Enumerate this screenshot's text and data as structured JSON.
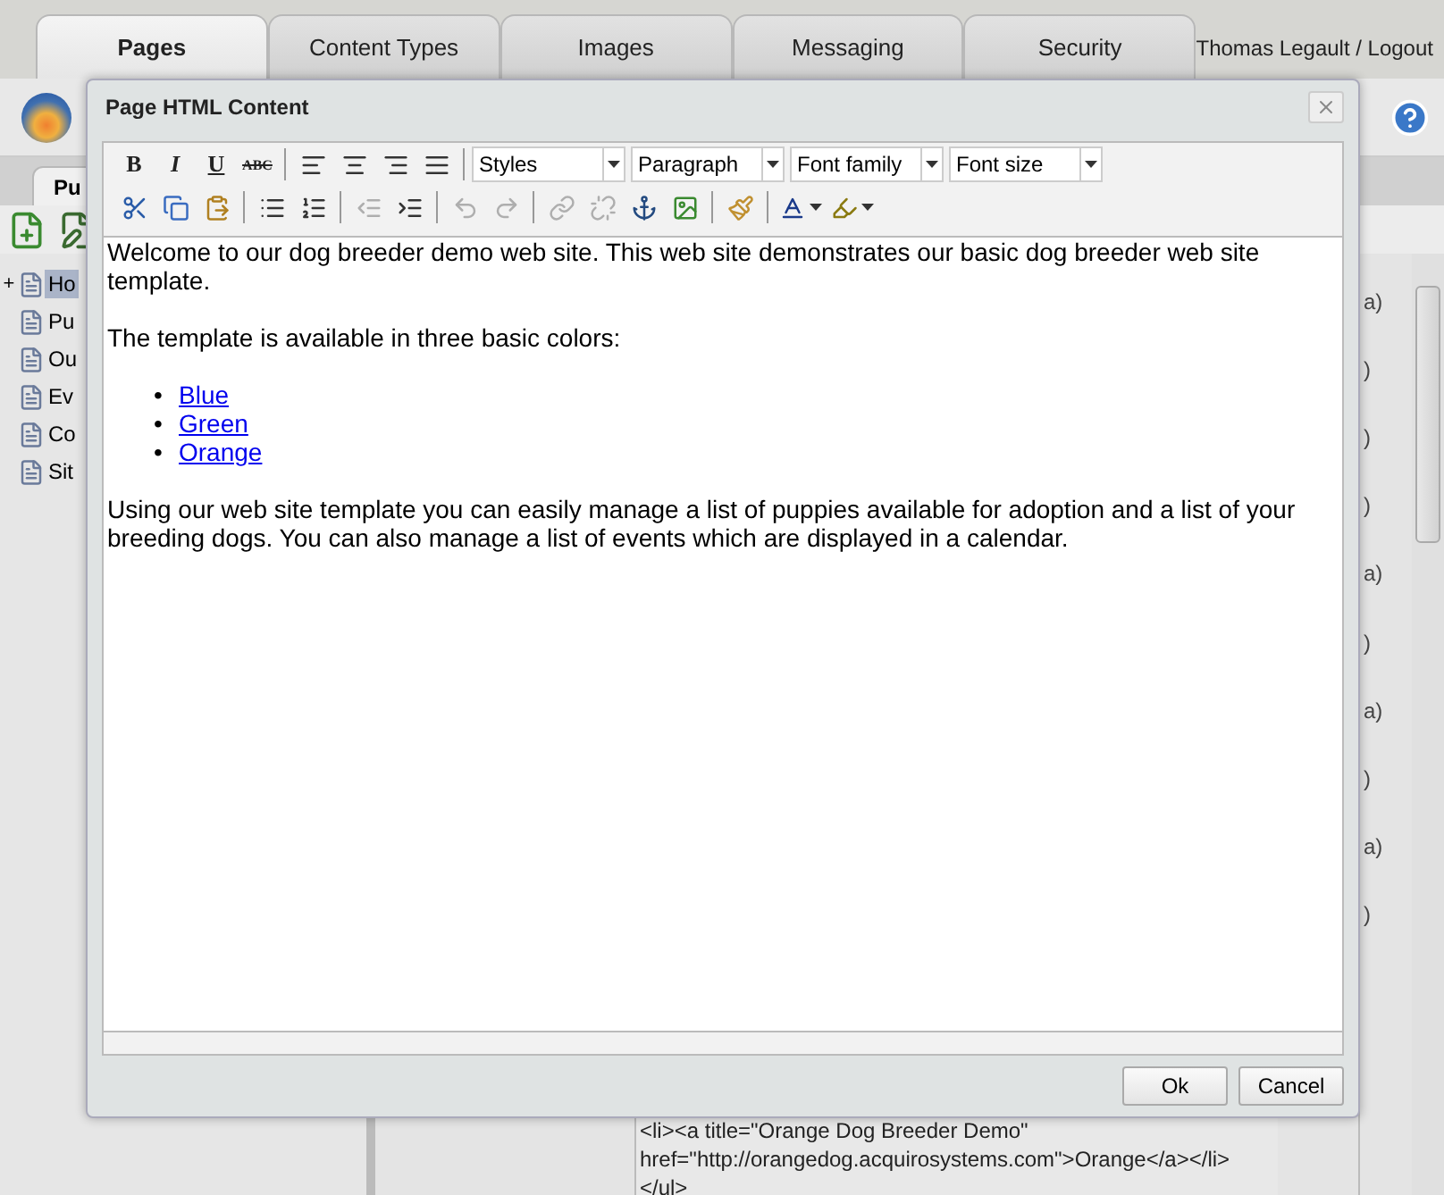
{
  "top_tabs": [
    {
      "label": "Pages",
      "selected": true
    },
    {
      "label": "Content Types",
      "selected": false
    },
    {
      "label": "Images",
      "selected": false
    },
    {
      "label": "Messaging",
      "selected": false
    },
    {
      "label": "Security",
      "selected": false
    }
  ],
  "user_link": "Thomas Legault / Logout",
  "sub_tab": {
    "label": "Pu",
    "selected": true
  },
  "tree": [
    {
      "label": "Ho",
      "selected": true,
      "expander": "+"
    },
    {
      "label": "Pu",
      "selected": false
    },
    {
      "label": "Ou",
      "selected": false
    },
    {
      "label": "Ev",
      "selected": false
    },
    {
      "label": "Co",
      "selected": false
    },
    {
      "label": "Sit",
      "selected": false
    }
  ],
  "right_fragments": [
    "a)",
    ")",
    ")",
    ")",
    "a)",
    ")",
    "a)",
    ")",
    "a)",
    ")"
  ],
  "code_lines": [
    "<li><a title=\"Orange Dog Breeder Demo\"",
    "href=\"http://orangedog.acquirosystems.com\">Orange</a></li>",
    "</ul>"
  ],
  "dialog": {
    "title": "Page HTML Content",
    "toolbar_rows": [
      [
        {
          "kind": "bold",
          "label": "B"
        },
        {
          "kind": "italic",
          "label": "I"
        },
        {
          "kind": "underline",
          "label": "U"
        },
        {
          "kind": "strike",
          "label": "ABC"
        },
        {
          "kind": "separator"
        },
        {
          "kind": "align-left",
          "disabled": false
        },
        {
          "kind": "align-center",
          "disabled": false
        },
        {
          "kind": "align-right",
          "disabled": false
        },
        {
          "kind": "align-justify",
          "disabled": false
        },
        {
          "kind": "separator"
        },
        {
          "kind": "select",
          "value": "Styles"
        },
        {
          "kind": "select",
          "value": "Paragraph"
        },
        {
          "kind": "select",
          "value": "Font family"
        },
        {
          "kind": "select",
          "value": "Font size"
        }
      ],
      [
        {
          "kind": "cut",
          "disabled": false
        },
        {
          "kind": "copy",
          "disabled": false
        },
        {
          "kind": "paste",
          "disabled": false
        },
        {
          "kind": "separator"
        },
        {
          "kind": "bullet-list",
          "disabled": false
        },
        {
          "kind": "numbered-list",
          "disabled": false
        },
        {
          "kind": "separator"
        },
        {
          "kind": "outdent",
          "disabled": true
        },
        {
          "kind": "indent",
          "disabled": false
        },
        {
          "kind": "separator"
        },
        {
          "kind": "undo",
          "disabled": true
        },
        {
          "kind": "redo",
          "disabled": true
        },
        {
          "kind": "separator"
        },
        {
          "kind": "link",
          "disabled": true
        },
        {
          "kind": "unlink",
          "disabled": true
        },
        {
          "kind": "anchor",
          "disabled": false
        },
        {
          "kind": "image",
          "disabled": false
        },
        {
          "kind": "separator"
        },
        {
          "kind": "cleanup",
          "disabled": false
        },
        {
          "kind": "separator"
        },
        {
          "kind": "text-color",
          "disabled": false
        },
        {
          "kind": "highlight",
          "disabled": false
        }
      ]
    ],
    "content": [
      {
        "kind": "paragraph",
        "text": "Welcome to our dog breeder demo web site. This web site demonstrates our basic dog breeder web site template."
      },
      {
        "kind": "paragraph",
        "text": "The template is available in three basic colors:"
      },
      {
        "kind": "list",
        "marker": "•",
        "items": [
          "Blue",
          "Green",
          "Orange"
        ]
      },
      {
        "kind": "paragraph",
        "text": "Using our web site template you can easily manage a list of puppies available for adoption and a list of your breeding dogs. You can also manage a list of events which are displayed in a calendar."
      }
    ],
    "buttons": [
      "Ok",
      "Cancel"
    ]
  }
}
